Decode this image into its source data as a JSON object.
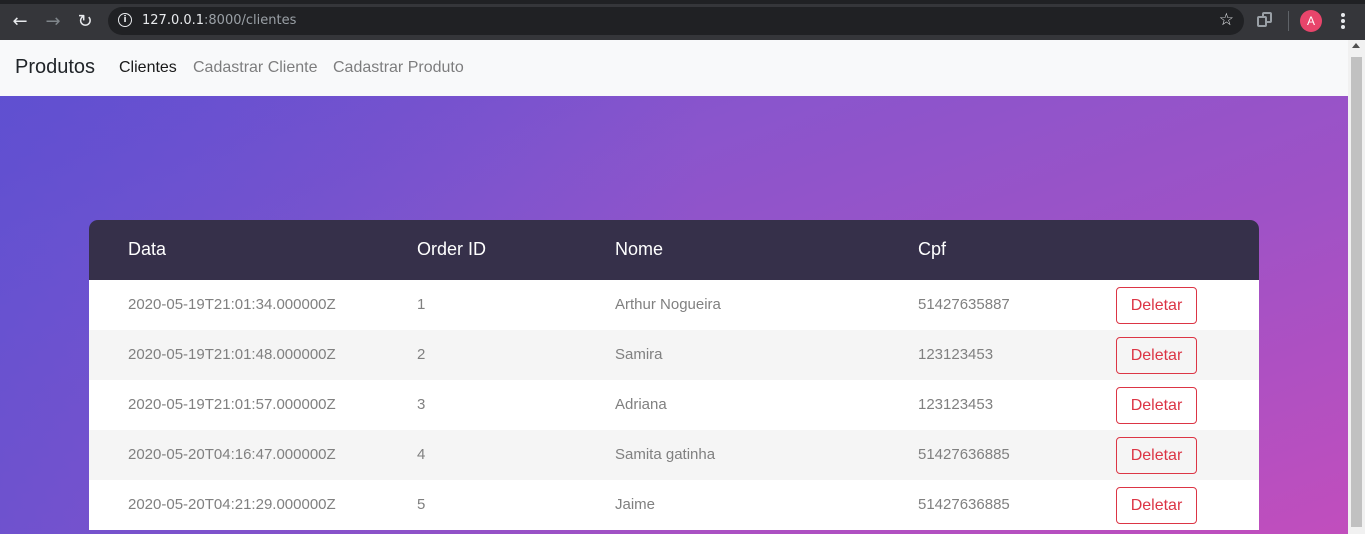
{
  "browser": {
    "url_host": "127.0.0.1",
    "url_rest": ":8000/clientes",
    "avatar_letter": "A",
    "icons": [
      "back-arrow-icon",
      "forward-arrow-icon",
      "reload-icon",
      "info-icon",
      "star-icon",
      "extensions-icon",
      "more-icon"
    ]
  },
  "navbar": {
    "brand": "Produtos",
    "links": [
      {
        "label": "Clientes",
        "active": true
      },
      {
        "label": "Cadastrar Cliente",
        "active": false
      },
      {
        "label": "Cadastrar Produto",
        "active": false
      }
    ]
  },
  "table": {
    "columns": [
      "Data",
      "Order ID",
      "Nome",
      "Cpf"
    ],
    "rows": [
      {
        "data": "2020-05-19T21:01:34.000000Z",
        "order_id": "1",
        "nome": "Arthur Nogueira",
        "cpf": "51427635887",
        "action": "Deletar"
      },
      {
        "data": "2020-05-19T21:01:48.000000Z",
        "order_id": "2",
        "nome": "Samira",
        "cpf": "123123453",
        "action": "Deletar"
      },
      {
        "data": "2020-05-19T21:01:57.000000Z",
        "order_id": "3",
        "nome": "Adriana",
        "cpf": "123123453",
        "action": "Deletar"
      },
      {
        "data": "2020-05-20T04:16:47.000000Z",
        "order_id": "4",
        "nome": "Samita gatinha",
        "cpf": "51427636885",
        "action": "Deletar"
      },
      {
        "data": "2020-05-20T04:21:29.000000Z",
        "order_id": "5",
        "nome": "Jaime",
        "cpf": "51427636885",
        "action": "Deletar"
      }
    ]
  },
  "colors": {
    "header_bg": "#36304a",
    "danger": "#dc3545",
    "gradient_start": "#6d4fd0",
    "gradient_end": "#c14ebd"
  }
}
